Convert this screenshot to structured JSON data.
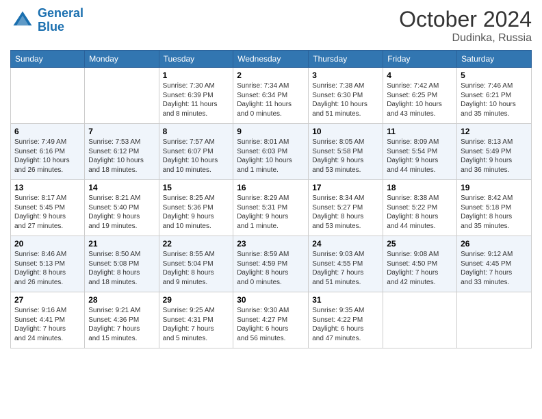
{
  "header": {
    "logo_line1": "General",
    "logo_line2": "Blue",
    "month": "October 2024",
    "location": "Dudinka, Russia"
  },
  "weekdays": [
    "Sunday",
    "Monday",
    "Tuesday",
    "Wednesday",
    "Thursday",
    "Friday",
    "Saturday"
  ],
  "weeks": [
    [
      {
        "day": "",
        "info": ""
      },
      {
        "day": "",
        "info": ""
      },
      {
        "day": "1",
        "info": "Sunrise: 7:30 AM\nSunset: 6:39 PM\nDaylight: 11 hours\nand 8 minutes."
      },
      {
        "day": "2",
        "info": "Sunrise: 7:34 AM\nSunset: 6:34 PM\nDaylight: 11 hours\nand 0 minutes."
      },
      {
        "day": "3",
        "info": "Sunrise: 7:38 AM\nSunset: 6:30 PM\nDaylight: 10 hours\nand 51 minutes."
      },
      {
        "day": "4",
        "info": "Sunrise: 7:42 AM\nSunset: 6:25 PM\nDaylight: 10 hours\nand 43 minutes."
      },
      {
        "day": "5",
        "info": "Sunrise: 7:46 AM\nSunset: 6:21 PM\nDaylight: 10 hours\nand 35 minutes."
      }
    ],
    [
      {
        "day": "6",
        "info": "Sunrise: 7:49 AM\nSunset: 6:16 PM\nDaylight: 10 hours\nand 26 minutes."
      },
      {
        "day": "7",
        "info": "Sunrise: 7:53 AM\nSunset: 6:12 PM\nDaylight: 10 hours\nand 18 minutes."
      },
      {
        "day": "8",
        "info": "Sunrise: 7:57 AM\nSunset: 6:07 PM\nDaylight: 10 hours\nand 10 minutes."
      },
      {
        "day": "9",
        "info": "Sunrise: 8:01 AM\nSunset: 6:03 PM\nDaylight: 10 hours\nand 1 minute."
      },
      {
        "day": "10",
        "info": "Sunrise: 8:05 AM\nSunset: 5:58 PM\nDaylight: 9 hours\nand 53 minutes."
      },
      {
        "day": "11",
        "info": "Sunrise: 8:09 AM\nSunset: 5:54 PM\nDaylight: 9 hours\nand 44 minutes."
      },
      {
        "day": "12",
        "info": "Sunrise: 8:13 AM\nSunset: 5:49 PM\nDaylight: 9 hours\nand 36 minutes."
      }
    ],
    [
      {
        "day": "13",
        "info": "Sunrise: 8:17 AM\nSunset: 5:45 PM\nDaylight: 9 hours\nand 27 minutes."
      },
      {
        "day": "14",
        "info": "Sunrise: 8:21 AM\nSunset: 5:40 PM\nDaylight: 9 hours\nand 19 minutes."
      },
      {
        "day": "15",
        "info": "Sunrise: 8:25 AM\nSunset: 5:36 PM\nDaylight: 9 hours\nand 10 minutes."
      },
      {
        "day": "16",
        "info": "Sunrise: 8:29 AM\nSunset: 5:31 PM\nDaylight: 9 hours\nand 1 minute."
      },
      {
        "day": "17",
        "info": "Sunrise: 8:34 AM\nSunset: 5:27 PM\nDaylight: 8 hours\nand 53 minutes."
      },
      {
        "day": "18",
        "info": "Sunrise: 8:38 AM\nSunset: 5:22 PM\nDaylight: 8 hours\nand 44 minutes."
      },
      {
        "day": "19",
        "info": "Sunrise: 8:42 AM\nSunset: 5:18 PM\nDaylight: 8 hours\nand 35 minutes."
      }
    ],
    [
      {
        "day": "20",
        "info": "Sunrise: 8:46 AM\nSunset: 5:13 PM\nDaylight: 8 hours\nand 26 minutes."
      },
      {
        "day": "21",
        "info": "Sunrise: 8:50 AM\nSunset: 5:08 PM\nDaylight: 8 hours\nand 18 minutes."
      },
      {
        "day": "22",
        "info": "Sunrise: 8:55 AM\nSunset: 5:04 PM\nDaylight: 8 hours\nand 9 minutes."
      },
      {
        "day": "23",
        "info": "Sunrise: 8:59 AM\nSunset: 4:59 PM\nDaylight: 8 hours\nand 0 minutes."
      },
      {
        "day": "24",
        "info": "Sunrise: 9:03 AM\nSunset: 4:55 PM\nDaylight: 7 hours\nand 51 minutes."
      },
      {
        "day": "25",
        "info": "Sunrise: 9:08 AM\nSunset: 4:50 PM\nDaylight: 7 hours\nand 42 minutes."
      },
      {
        "day": "26",
        "info": "Sunrise: 9:12 AM\nSunset: 4:45 PM\nDaylight: 7 hours\nand 33 minutes."
      }
    ],
    [
      {
        "day": "27",
        "info": "Sunrise: 9:16 AM\nSunset: 4:41 PM\nDaylight: 7 hours\nand 24 minutes."
      },
      {
        "day": "28",
        "info": "Sunrise: 9:21 AM\nSunset: 4:36 PM\nDaylight: 7 hours\nand 15 minutes."
      },
      {
        "day": "29",
        "info": "Sunrise: 9:25 AM\nSunset: 4:31 PM\nDaylight: 7 hours\nand 5 minutes."
      },
      {
        "day": "30",
        "info": "Sunrise: 9:30 AM\nSunset: 4:27 PM\nDaylight: 6 hours\nand 56 minutes."
      },
      {
        "day": "31",
        "info": "Sunrise: 9:35 AM\nSunset: 4:22 PM\nDaylight: 6 hours\nand 47 minutes."
      },
      {
        "day": "",
        "info": ""
      },
      {
        "day": "",
        "info": ""
      }
    ]
  ]
}
